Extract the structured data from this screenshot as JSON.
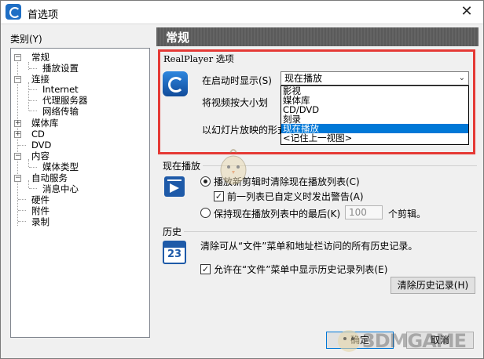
{
  "window": {
    "title": "首选项",
    "close_glyph": "✕"
  },
  "category_label": "类别(Y)",
  "tree": {
    "items": [
      {
        "label": "常规",
        "expander": "−"
      },
      {
        "label": "播放设置"
      },
      {
        "label": "连接",
        "expander": "−"
      },
      {
        "label": "Internet"
      },
      {
        "label": "代理服务器"
      },
      {
        "label": "网络传输"
      },
      {
        "label": "媒体库",
        "expander": "+"
      },
      {
        "label": "CD",
        "expander": "+"
      },
      {
        "label": "DVD"
      },
      {
        "label": "内容",
        "expander": "−"
      },
      {
        "label": "媒体类型"
      },
      {
        "label": "自动服务",
        "expander": "−"
      },
      {
        "label": "消息中心"
      },
      {
        "label": "硬件"
      },
      {
        "label": "附件"
      },
      {
        "label": "录制"
      }
    ]
  },
  "panel_title": "常规",
  "realplayer": {
    "group_title": "RealPlayer 选项",
    "startup_label": "在启动时显示(S)",
    "startup_value": "现在播放",
    "dropdown_options": [
      "影视",
      "媒体库",
      "CD/DVD",
      "刻录",
      "现在播放",
      "<记住上一视图>"
    ],
    "dropdown_selected_index": 4,
    "zoom_label": "将视频按大小划",
    "slideshow_label": "以幻灯片放映的形式"
  },
  "now_playing": {
    "group_title": "现在播放",
    "radio1_label": "播放新剪辑时清除现在播放列表(C)",
    "check1_label": "前一列表已自定义时发出警告(A)",
    "radio2_label": "保持现在播放列表中的最后(K)",
    "keep_count": "100",
    "clips_suffix": "个剪辑。"
  },
  "history": {
    "group_title": "历史",
    "description": "清除可从“文件”菜单和地址栏访问的所有历史记录。",
    "calendar_number": "23",
    "check_label": "允许在“文件”菜单中显示历史记录列表(E)",
    "clear_button": "清除历史记录(H)"
  },
  "buttons": {
    "ok": "确定",
    "cancel": "取消"
  },
  "watermark": "3DMGAME",
  "colors": {
    "highlight": "#e53935",
    "selection": "#0078d7",
    "icon_blue": "#1e5aa8"
  }
}
